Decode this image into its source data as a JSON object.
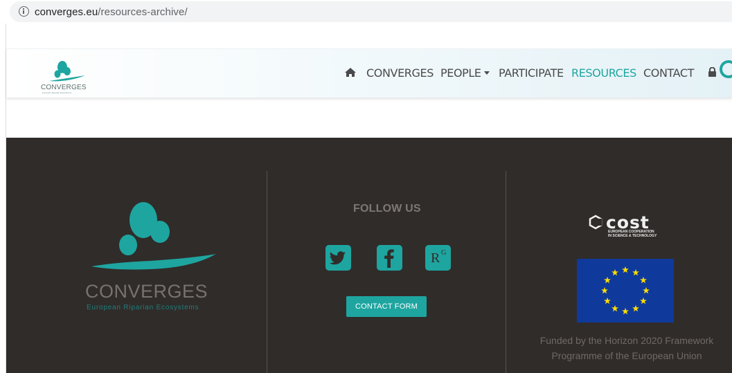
{
  "browser": {
    "url_domain": "converges.eu",
    "url_path": "/resources-archive/"
  },
  "header": {
    "logo_text": "CONVERGES",
    "logo_subtext": "European Riparian Ecosystems",
    "nav": {
      "converges": "CONVERGES",
      "people": "PEOPLE",
      "participate": "PARTICIPATE",
      "resources": "RESOURCES",
      "contact": "CONTACT"
    }
  },
  "footer": {
    "logo_text": "CONVERGES",
    "logo_subtext": "European Riparian Ecosystems",
    "follow_title": "FOLLOW US",
    "social": [
      "twitter-icon",
      "facebook-icon",
      "researchgate-icon"
    ],
    "researchgate_label": "R",
    "researchgate_sup": "G",
    "contact_button": "CONTACT FORM",
    "cost_logo": "cost",
    "cost_line1": "EUROPEAN COOPERATION",
    "cost_line2": "IN SCIENCE & TECHNOLOGY",
    "funded_line1": "Funded by the Horizon 2020 Framework",
    "funded_line2": "Programme of the European Union"
  },
  "colors": {
    "accent": "#1ea5a0",
    "footer_bg": "#302c2a",
    "eu_blue": "#0f3a9c",
    "eu_star": "#ffdd00"
  }
}
